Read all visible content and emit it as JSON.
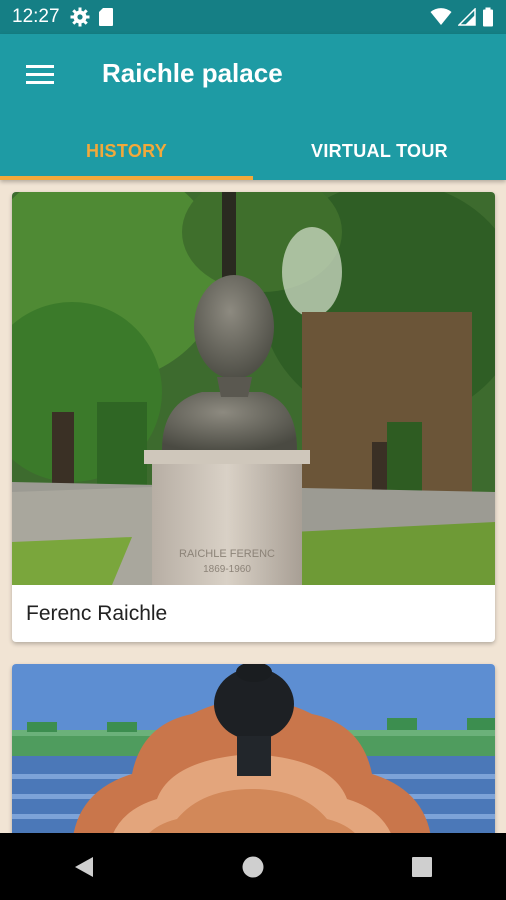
{
  "status_bar": {
    "time": "12:27",
    "left_icons": [
      "settings-icon",
      "sd-card-icon"
    ],
    "right_icons": [
      "wifi-icon",
      "signal-icon",
      "battery-icon"
    ]
  },
  "app_bar": {
    "title": "Raichle palace",
    "menu_icon": "menu-icon",
    "color": "#1e9ba4"
  },
  "tabs": [
    {
      "label": "HISTORY",
      "active": true
    },
    {
      "label": "VIRTUAL TOUR",
      "active": false
    }
  ],
  "colors": {
    "accent": "#f2a93b",
    "background": "#f1e4d4",
    "status_bar": "#157f85"
  },
  "cards": [
    {
      "title": "Ferenc Raichle",
      "image": "bust-statue-photo"
    },
    {
      "title": "",
      "image": "ornate-building-roof-photo"
    }
  ],
  "nav_bar": {
    "buttons": [
      "back-icon",
      "home-icon",
      "recents-icon"
    ]
  }
}
